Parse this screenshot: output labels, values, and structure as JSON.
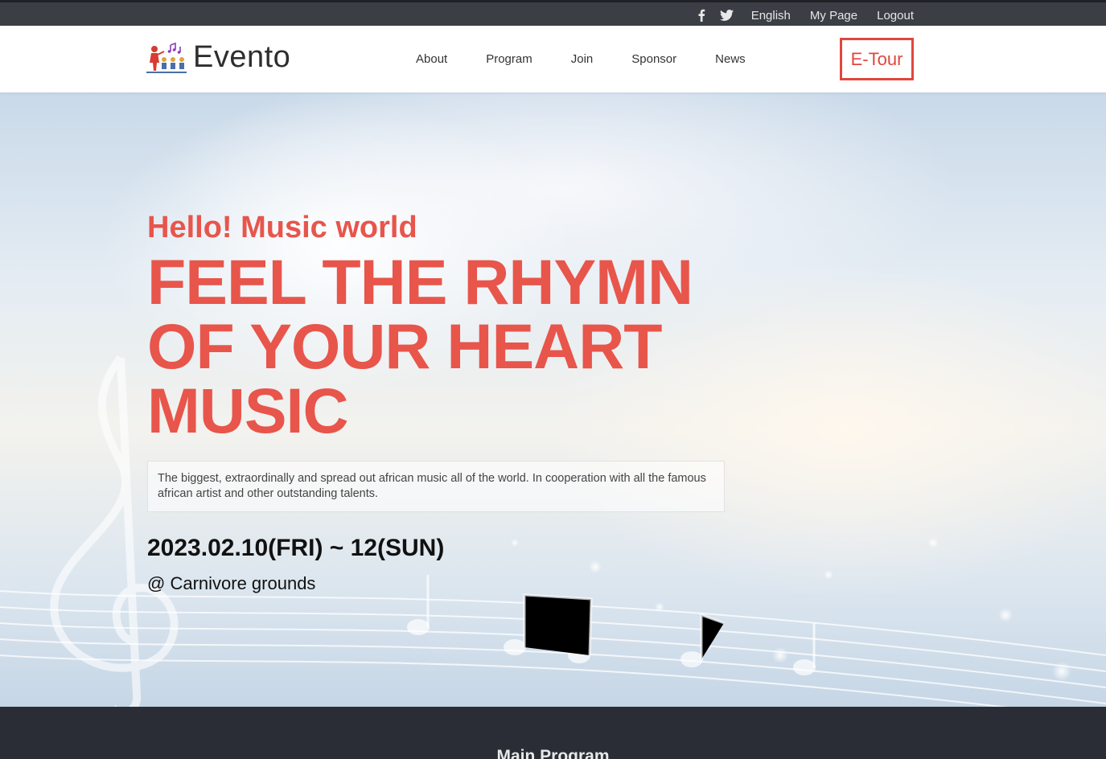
{
  "topbar": {
    "social": [
      "facebook-icon",
      "twitter-icon"
    ],
    "links": [
      "English",
      "My Page",
      "Logout"
    ]
  },
  "header": {
    "logo_text": "Evento",
    "nav": [
      "About",
      "Program",
      "Join",
      "Sponsor",
      "News"
    ],
    "etour_label": "E-Tour"
  },
  "hero": {
    "greeting": "Hello! Music world",
    "headline_lines": [
      "FEEL THE RHYMN",
      "OF YOUR HEART",
      "MUSIC"
    ],
    "description": "The biggest, extraordinally and spread out african music all of the world. In cooperation with all the famous african artist and other outstanding talents.",
    "date": "2023.02.10(FRI) ~ 12(SUN)",
    "venue": "@ Carnivore grounds"
  },
  "section": {
    "title": "Main Program"
  },
  "colors": {
    "accent": "#e8554b",
    "topbar_bg": "#3b3e45",
    "band_bg": "#2a2d35"
  }
}
